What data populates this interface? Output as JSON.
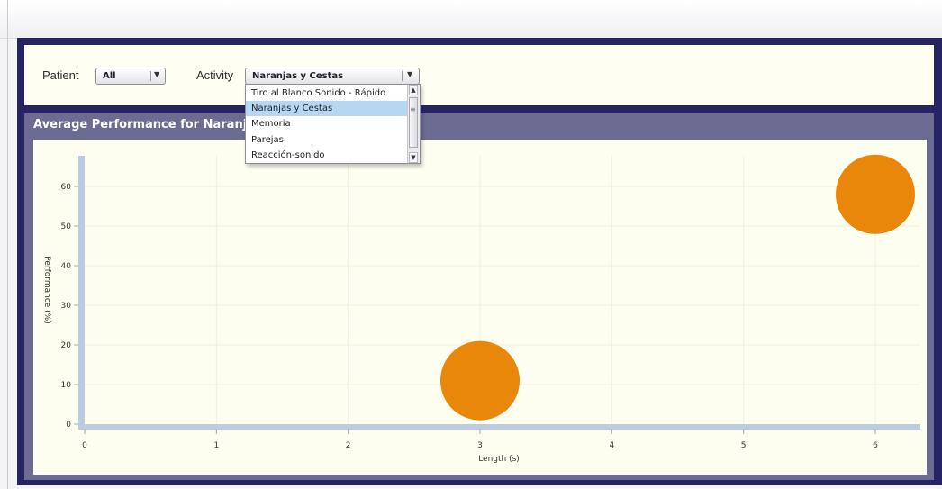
{
  "filters": {
    "patient_label": "Patient",
    "patient_value": "All",
    "activity_label": "Activity",
    "activity_value": "Naranjas y Cestas"
  },
  "activity_options": [
    {
      "label": "Tiro al Blanco Sonido - Rápido",
      "selected": false
    },
    {
      "label": "Naranjas y Cestas",
      "selected": true
    },
    {
      "label": "Memoria",
      "selected": false
    },
    {
      "label": "Parejas",
      "selected": false
    },
    {
      "label": "Reacción-sonido",
      "selected": false
    }
  ],
  "chart_panel_title": "Average Performance for Naranjas",
  "icons": {
    "dropdown_arrow": "▼",
    "scroll_up": "▲",
    "scroll_down": "▼",
    "scroll_grip": "≡"
  },
  "colors": {
    "bubble": "#e8870a",
    "axis": "#bccbe0",
    "frame": "#272466",
    "panel": "#6c6c93"
  },
  "chart_data": {
    "type": "scatter",
    "xlabel": "Length (s)",
    "ylabel": "Performance (%)",
    "xlim": [
      0,
      6.3
    ],
    "ylim": [
      0,
      68
    ],
    "x_ticks": [
      0,
      1,
      2,
      3,
      4,
      5,
      6
    ],
    "y_ticks": [
      0,
      10,
      20,
      30,
      40,
      50,
      60
    ],
    "series": [
      {
        "points": [
          {
            "x": 3,
            "y": 11,
            "r": 10
          },
          {
            "x": 6,
            "y": 58,
            "r": 10
          }
        ]
      }
    ]
  }
}
